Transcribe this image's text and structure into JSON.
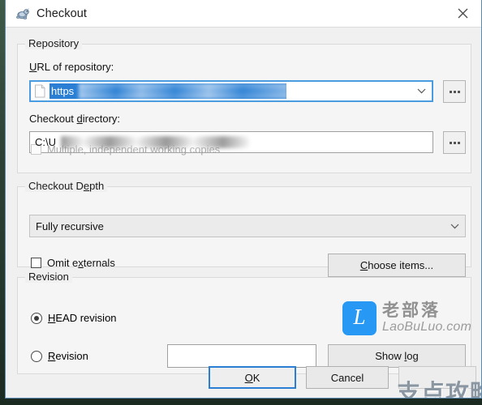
{
  "window": {
    "title": "Checkout",
    "icon": "tortoise-svn-icon",
    "close_label": "×"
  },
  "repository": {
    "group_title": "Repository",
    "url_label_pre": "U",
    "url_label_post": "RL of repository:",
    "url_value": "https",
    "url_icon": "document-icon",
    "url_dropdown_icon": "chevron-down-icon",
    "browse_url_label": "...",
    "dir_label_pre": "Checkout ",
    "dir_label_mid": "d",
    "dir_label_post": "irectory:",
    "dir_value": "C:\\U",
    "browse_dir_label": "...",
    "multiple_checkbox_label": "Multiple, independent working copies",
    "multiple_checked": false,
    "multiple_enabled": false
  },
  "depth": {
    "group_title_pre": "Checkout D",
    "group_title_mid": "e",
    "group_title_post": "pth",
    "selected": "Fully recursive",
    "dropdown_icon": "chevron-down-icon",
    "omit_label_pre": "Omit e",
    "omit_label_mid": "x",
    "omit_label_post": "ternals",
    "omit_checked": false,
    "choose_items_pre": "C",
    "choose_items_post": "hoose items..."
  },
  "revision": {
    "group_title": "Revision",
    "head_label_pre": "H",
    "head_label_post": "EAD revision",
    "head_selected": true,
    "rev_label_pre": "R",
    "rev_label_post": "evision",
    "rev_selected": false,
    "rev_value": "",
    "show_log_pre": "Show ",
    "show_log_mid": "l",
    "show_log_post": "og"
  },
  "footer": {
    "ok_pre": "O",
    "ok_post": "K",
    "ok_is_default": true,
    "cancel_label": "Cancel",
    "help_label": ""
  },
  "watermarks": {
    "laobuluo_cn": "老部落",
    "laobuluo_en": "LaoBuLuo.com",
    "laobuluo_logo_letter": "L",
    "zhidian": "支点攻略"
  },
  "colors": {
    "accent": "#2a7fd4",
    "dialog_bg": "#f0f0f0",
    "group_bg": "#f5f5f5",
    "watermark_blue": "#2196f3"
  }
}
